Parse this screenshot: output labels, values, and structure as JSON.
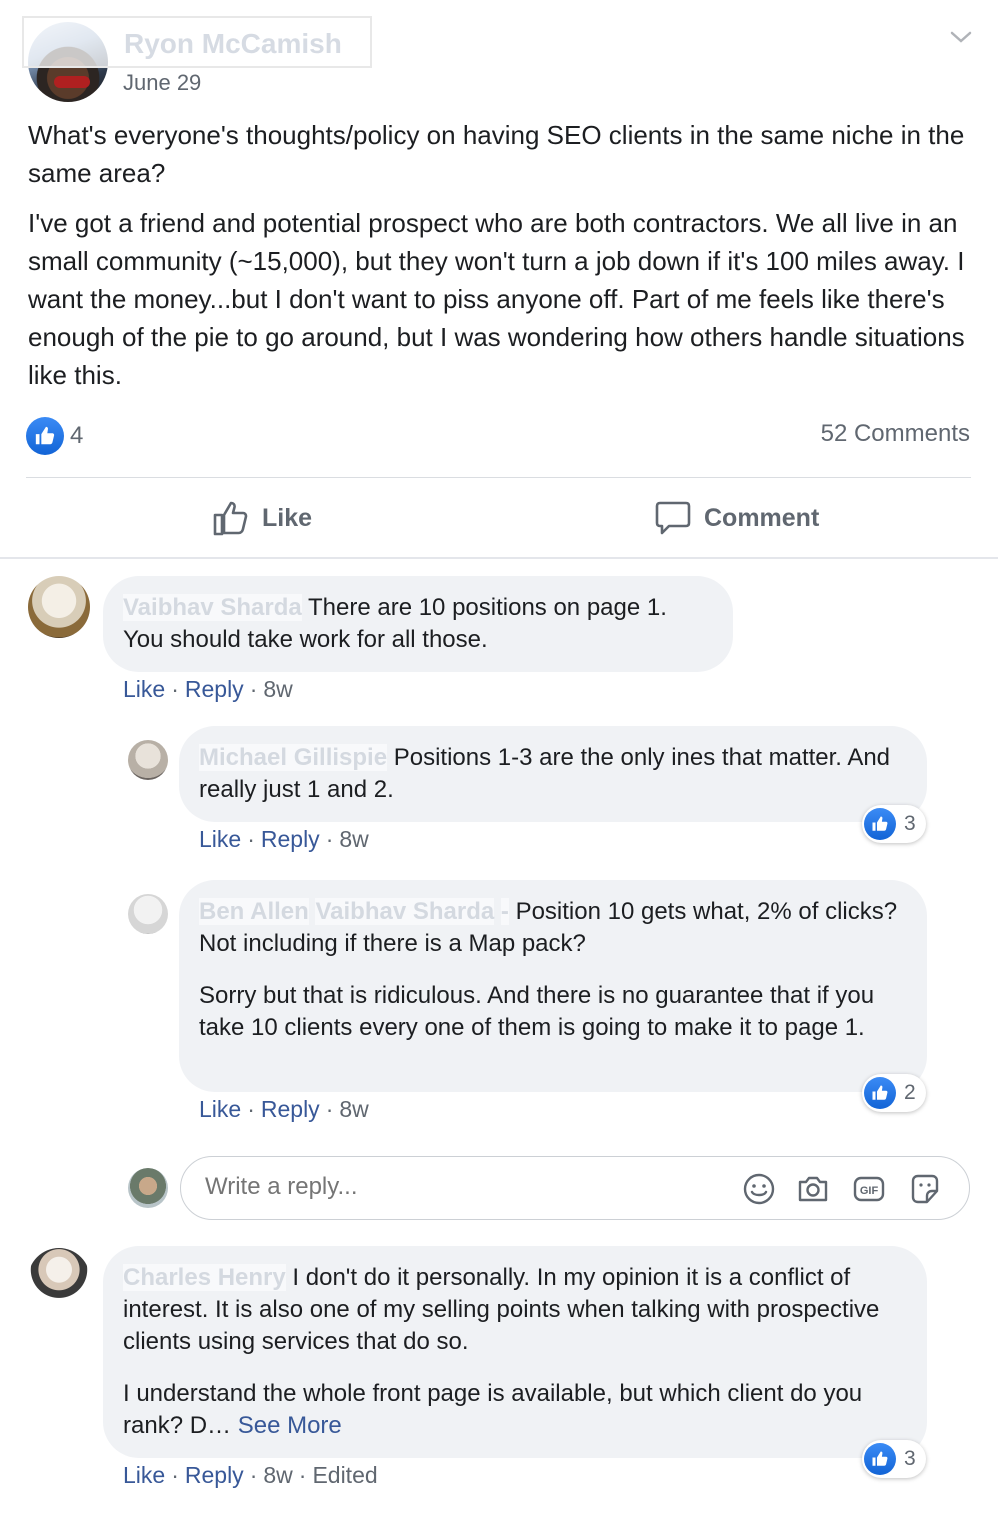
{
  "post": {
    "author": "Ryon McCamish",
    "date": "June 29",
    "paragraphs": [
      "What's everyone's thoughts/policy on having SEO clients in the same niche in the same area?",
      "I've got a friend and potential prospect who are both contractors. We all live in an small community (~15,000), but they won't turn a job down if it's 100 miles away. I want the money...but I don't want to piss anyone off. Part of me feels like there's enough of the pie to go around, but I was wondering how others handle situations like this."
    ],
    "like_count": "4",
    "comments_count": "52 Comments"
  },
  "actions": {
    "like": "Like",
    "comment": "Comment"
  },
  "comments": [
    {
      "author": "Vaibhav Sharda",
      "text": "There are 10 positions on page 1. You should take work for all those.",
      "like": "Like",
      "reply": "Reply",
      "time": "8w"
    },
    {
      "author": "Michael Gillispie",
      "text": "Positions 1-3 are the only ines that matter. And really just 1 and 2.",
      "like": "Like",
      "reply": "Reply",
      "time": "8w",
      "reactions": "3"
    },
    {
      "author": "Ben Allen",
      "mention": "Vaibhav Sharda",
      "text1": "Position 10 gets what, 2% of clicks? Not including if there is a Map pack?",
      "text2": "Sorry but that is ridiculous. And there is no guarantee that if you take 10 clients every one of them is going to make it to page 1.",
      "like": "Like",
      "reply": "Reply",
      "time": "8w",
      "reactions": "2"
    },
    {
      "author": "Charles Henry",
      "text1": "I don't do it personally. In my opinion it is a conflict of interest. It is also one of my selling points when talking with prospective clients using services that do so.",
      "text2": "I understand the whole front page is available, but which client do you rank? D…",
      "see_more": "See More",
      "like": "Like",
      "reply": "Reply",
      "time": "8w",
      "edited": "Edited",
      "reactions": "3"
    }
  ],
  "reply_box": {
    "placeholder": "Write a reply..."
  },
  "colors": {
    "brand": "#1877f2",
    "link": "#385898",
    "bubble": "#f0f2f5"
  }
}
